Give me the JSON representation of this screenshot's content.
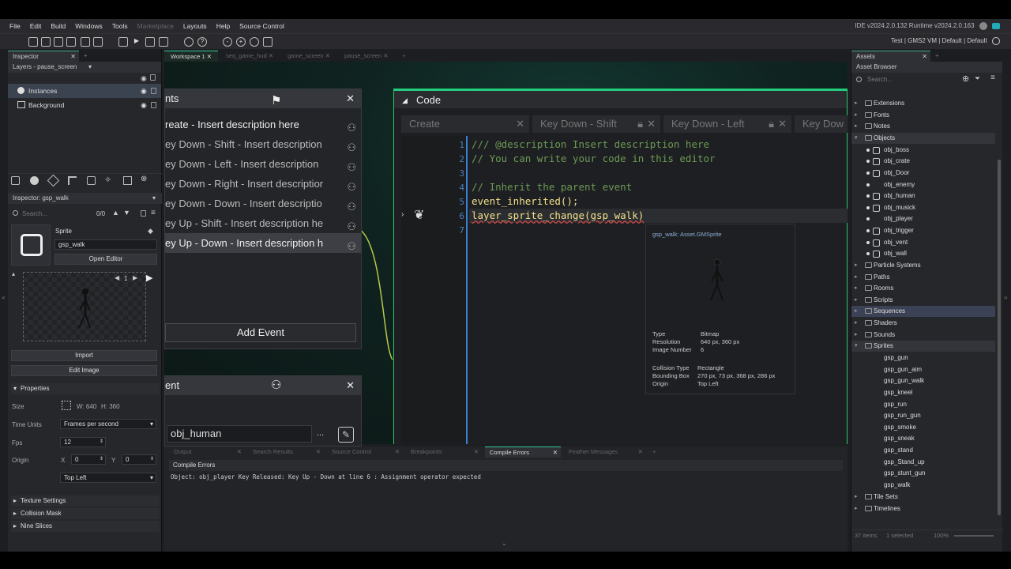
{
  "menu": [
    "File",
    "Edit",
    "Build",
    "Windows",
    "Tools",
    "Marketplace",
    "Layouts",
    "Help",
    "Source Control"
  ],
  "version": "IDE v2024.2.0.132  Runtime v2024.2.0.163",
  "config": "Test  |  GMS2 VM  |  Default  |  Default",
  "inspector": {
    "tab": "Inspector",
    "layers_title": "Layers - pause_screen",
    "layers": [
      "Instances",
      "Background"
    ],
    "title2": "Inspector: gsp_walk",
    "search_placeholder": "Search...",
    "search_count": "0/0",
    "sprite_label": "Sprite",
    "sprite_name": "gsp_walk",
    "open_editor": "Open Editor",
    "frame": "1",
    "import": "Import",
    "edit_image": "Edit Image",
    "properties": "Properties",
    "size_label": "Size",
    "size_w": "W: 640",
    "size_h": "H: 360",
    "time_units_label": "Time Units",
    "time_units": "Frames per second",
    "fps_label": "Fps",
    "fps": "12",
    "origin_label": "Origin",
    "origin_x_label": "X",
    "origin_x": "0",
    "origin_y_label": "Y",
    "origin_y": "0",
    "origin_mode": "Top Left",
    "sections": [
      "Texture Settings",
      "Collision Mask",
      "Nine Slices"
    ]
  },
  "workspace_tabs": [
    "Workspace 1",
    "seq_game_hud",
    "game_screen",
    "pause_screen"
  ],
  "events": {
    "title": "nts",
    "items": [
      "reate - Insert description here",
      "ey Down - Shift - Insert description",
      "ey Down - Left - Insert description",
      "ey Down - Right - Insert descriptior",
      "ey Down - Down - Insert descriptio",
      "ey Up - Shift - Insert description he",
      "ey Up - Down - Insert description h"
    ],
    "add_event": "Add Event"
  },
  "object": {
    "title": "ent",
    "name": "obj_human",
    "more": "..."
  },
  "code": {
    "title": "Code",
    "tabs": [
      "Create",
      "Key Down - Shift",
      "Key Down - Left",
      "Key Dow"
    ],
    "lines": [
      {
        "n": "1",
        "text": "/// @description Insert description here",
        "kind": "cmt"
      },
      {
        "n": "2",
        "text": "// You can write your code in this editor",
        "kind": "cmt"
      },
      {
        "n": "3",
        "text": "",
        "kind": "cmt"
      },
      {
        "n": "4",
        "text": "// Inherit the parent event",
        "kind": "cmt"
      },
      {
        "n": "5",
        "text": "event_inherited();",
        "kind": "fn"
      },
      {
        "n": "6",
        "text": "layer_sprite_change(gsp_walk)",
        "kind": "fn"
      },
      {
        "n": "7",
        "text": "",
        "kind": "fn"
      }
    ]
  },
  "tooltip": {
    "title": "gsp_walk: Asset.GMSprite",
    "type_label": "Type",
    "type": "Bitmap",
    "res_label": "Resolution",
    "res": "640 px, 360 px",
    "imgnum_label": "Image Number",
    "imgnum": "6",
    "coll_label": "Collision Type",
    "coll": "Rectangle",
    "bbox_label": "Bounding Box",
    "bbox": "270 px, 73 px, 368 px, 286 px",
    "origin_label": "Origin",
    "origin": "Top Left"
  },
  "output": {
    "tabs": [
      "Output",
      "Search Results",
      "Source Control",
      "Breakpoints",
      "Compile Errors",
      "Feather Messages"
    ],
    "header": "Compile Errors",
    "message": "Object: obj_player Key Released: Key Up - Down at line 6 : Assignment operator expected"
  },
  "assets": {
    "tab": "Assets",
    "title": "Asset Browser",
    "search_placeholder": "Search...",
    "groups_top": [
      "Extensions",
      "Fonts",
      "Notes"
    ],
    "objects_label": "Objects",
    "objects": [
      "obj_boss",
      "obj_crate",
      "obj_Door",
      "obj_enemy",
      "obj_human",
      "obj_musick",
      "obj_player",
      "obj_trigger",
      "obj_vent",
      "obj_wall"
    ],
    "groups_mid": [
      "Particle Systems",
      "Paths",
      "Rooms",
      "Scripts",
      "Sequences",
      "Shaders",
      "Sounds"
    ],
    "sprites_label": "Sprites",
    "sprites": [
      "gsp_gun",
      "gsp_gun_aim",
      "gsp_gun_walk",
      "gsp_kneel",
      "gsp_run",
      "gsp_run_gun",
      "gsp_smoke",
      "gsp_sneak",
      "gsp_stand",
      "gsp_Stand_up",
      "gsp_stunt_gun",
      "gsp_walk"
    ],
    "groups_bot": [
      "Tile Sets",
      "Timelines"
    ],
    "footer_items": "37 items",
    "footer_sel": "1 selected",
    "zoom": "100%"
  }
}
